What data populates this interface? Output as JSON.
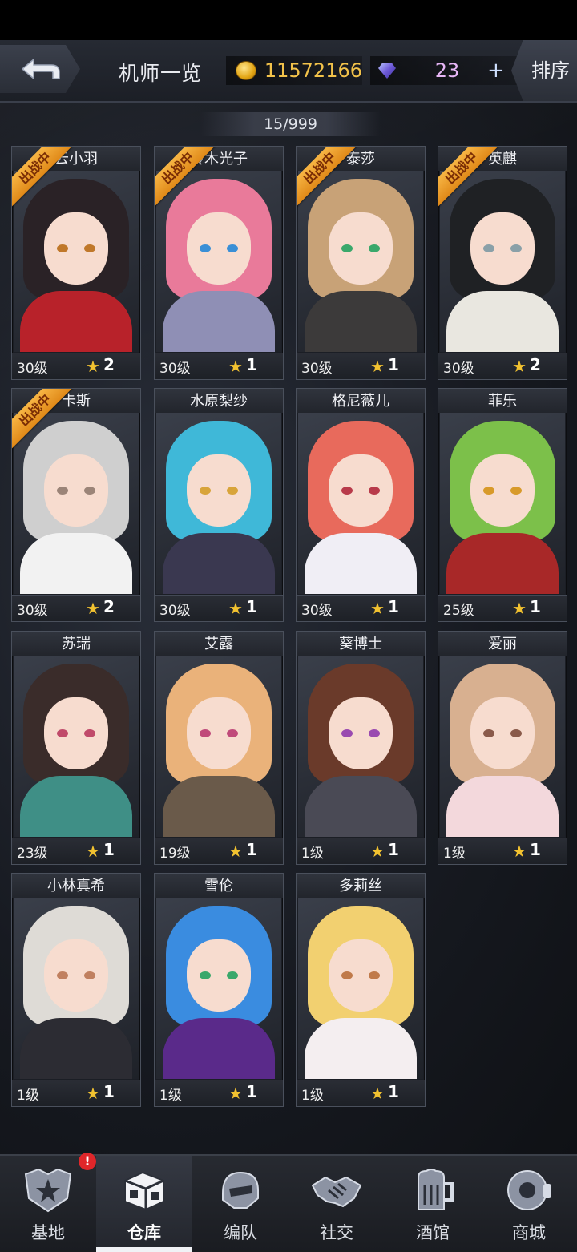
{
  "header": {
    "title": "机师一览",
    "coins": "11572166",
    "gems": "23",
    "plus_label": "+",
    "sort_label": "排序"
  },
  "count": "15/999",
  "deploy_label": "出战中",
  "pilots": [
    {
      "name": "云小羽",
      "shown_name": "云小羽",
      "level": "30级",
      "stars": "2",
      "deployed": true,
      "hair": "#2a2226",
      "body": "#b8222a",
      "eye": "#c0782a"
    },
    {
      "name": "铃木光子",
      "shown_name": "铃木光子",
      "level": "30级",
      "stars": "1",
      "deployed": true,
      "hair": "#e97a9a",
      "body": "#8f8fb5",
      "eye": "#3a8fd6"
    },
    {
      "name": "泰莎",
      "shown_name": "泰莎",
      "level": "30级",
      "stars": "1",
      "deployed": true,
      "hair": "#c8a277",
      "body": "#3c3a3a",
      "eye": "#3aa86b"
    },
    {
      "name": "英麒",
      "shown_name": "英麒",
      "level": "30级",
      "stars": "2",
      "deployed": true,
      "hair": "#1f2124",
      "body": "#e9e7e0",
      "eye": "#8aa0a8"
    },
    {
      "name": "卡斯",
      "shown_name": "卡斯",
      "level": "30级",
      "stars": "2",
      "deployed": true,
      "hair": "#cfcfcf",
      "body": "#f2f2f2",
      "eye": "#9b8478"
    },
    {
      "name": "水原梨纱",
      "shown_name": "水原梨纱",
      "level": "30级",
      "stars": "1",
      "deployed": false,
      "hair": "#3fb8d8",
      "body": "#3a3850",
      "eye": "#d8a43a"
    },
    {
      "name": "格尼薇儿",
      "shown_name": "格尼薇儿",
      "level": "30级",
      "stars": "1",
      "deployed": false,
      "hair": "#e86a5c",
      "body": "#f0eef5",
      "eye": "#b83a4a"
    },
    {
      "name": "菲乐",
      "shown_name": "菲乐",
      "level": "25级",
      "stars": "1",
      "deployed": false,
      "hair": "#7cc04a",
      "body": "#a82828",
      "eye": "#d89a2a"
    },
    {
      "name": "苏瑞",
      "shown_name": "苏瑞",
      "level": "23级",
      "stars": "1",
      "deployed": false,
      "hair": "#3a2c2a",
      "body": "#3f8f86",
      "eye": "#c04a6a"
    },
    {
      "name": "艾露",
      "shown_name": "艾露",
      "level": "19级",
      "stars": "1",
      "deployed": false,
      "hair": "#eab27a",
      "body": "#6a5a4a",
      "eye": "#c04a7a"
    },
    {
      "name": "葵博士",
      "shown_name": "葵博士",
      "level": "1级",
      "stars": "1",
      "deployed": false,
      "hair": "#6a3a2a",
      "body": "#4a4a55",
      "eye": "#9a4ab0"
    },
    {
      "name": "爱丽",
      "shown_name": "爱丽",
      "level": "1级",
      "stars": "1",
      "deployed": false,
      "hair": "#d8b090",
      "body": "#f3d8dc",
      "eye": "#8a5a4a"
    },
    {
      "name": "小林真希",
      "shown_name": "小林真希",
      "level": "1级",
      "stars": "1",
      "deployed": false,
      "hair": "#dedbd6",
      "body": "#2c2c33",
      "eye": "#c08060"
    },
    {
      "name": "雪伦",
      "shown_name": "雪伦",
      "level": "1级",
      "stars": "1",
      "deployed": false,
      "hair": "#3a8ce0",
      "body": "#5a2a8a",
      "eye": "#3aa86b"
    },
    {
      "name": "多莉丝",
      "shown_name": "多莉丝",
      "level": "1级",
      "stars": "1",
      "deployed": false,
      "hair": "#f2d070",
      "body": "#f4eef0",
      "eye": "#c07a4a"
    }
  ],
  "nav": [
    {
      "label": "基地",
      "icon": "base-star-icon",
      "alert": "!"
    },
    {
      "label": "仓库",
      "icon": "warehouse-cube-icon",
      "active": true
    },
    {
      "label": "编队",
      "icon": "team-helmet-icon"
    },
    {
      "label": "社交",
      "icon": "handshake-icon"
    },
    {
      "label": "酒馆",
      "icon": "beer-mug-icon"
    },
    {
      "label": "商城",
      "icon": "shop-robot-icon"
    }
  ]
}
